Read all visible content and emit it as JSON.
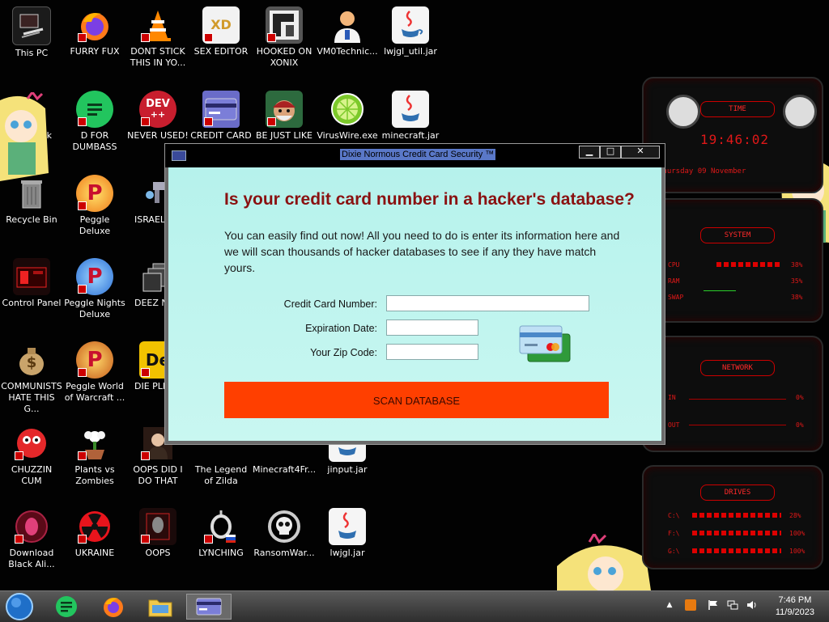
{
  "desktop": {
    "icons": [
      {
        "label": "This PC"
      },
      {
        "label": "FURRY FUX"
      },
      {
        "label": "DONT STICK THIS IN YO..."
      },
      {
        "label": "SEX EDITOR"
      },
      {
        "label": "HOOKED ON XONIX"
      },
      {
        "label": "VM0Technic..."
      },
      {
        "label": "lwjgl_util.jar"
      },
      {
        "label": "k"
      },
      {
        "label": "D FOR DUMBASS"
      },
      {
        "label": "NEVER USED!"
      },
      {
        "label": "CREDIT CARD CHECKER"
      },
      {
        "label": "BE JUST LIKE THE DUDE!"
      },
      {
        "label": "VirusWire.exe"
      },
      {
        "label": "minecraft.jar"
      },
      {
        "label": "Recycle Bin"
      },
      {
        "label": "Peggle Deluxe"
      },
      {
        "label": "ISRAELS"
      },
      {
        "label": "Control Panel"
      },
      {
        "label": "Peggle Nights Deluxe"
      },
      {
        "label": "DEEZ NU"
      },
      {
        "label": "COMMUNISTS HATE THIS G..."
      },
      {
        "label": "Peggle World of Warcraft ..."
      },
      {
        "label": "DIE PLEA"
      },
      {
        "label": "CHUZZIN CUM"
      },
      {
        "label": "Plants vs Zombies"
      },
      {
        "label": "OOPS DID I DO THAT"
      },
      {
        "label": "The Legend of Zilda"
      },
      {
        "label": "Minecraft4Fr..."
      },
      {
        "label": "jinput.jar"
      },
      {
        "label": "Download Black Ali..."
      },
      {
        "label": "UKRAINE"
      },
      {
        "label": "OOPS"
      },
      {
        "label": "LYNCHING"
      },
      {
        "label": "RansomWar..."
      },
      {
        "label": "lwjgl.jar"
      }
    ],
    "icon_glyphs": {
      "dev": "DEV",
      "dev_sub": "++",
      "xd": "XD",
      "p": "P",
      "dollar": "$",
      "de": "De"
    }
  },
  "widget": {
    "time_title": "TIME",
    "time_value": "19:46:02",
    "date_value": "Thursday 09 November",
    "system_title": "SYSTEM",
    "cpu_label": "CPU",
    "cpu_value": "38%",
    "ram_label": "RAM",
    "ram_value": "35%",
    "swap_label": "SWAP",
    "swap_value": "38%",
    "network_title": "NETWORK",
    "in_label": "IN",
    "in_value": "0%",
    "out_label": "OUT",
    "out_value": "0%",
    "drives_title": "DRIVES",
    "drives": [
      {
        "label": "C:\\",
        "value": "28%"
      },
      {
        "label": "F:\\",
        "value": "100%"
      },
      {
        "label": "G:\\",
        "value": "100%"
      }
    ]
  },
  "dialog": {
    "title": "Dixie Normous Credit Card Security ™",
    "minimize": "▁",
    "maximize": "□",
    "close": "✕",
    "headline": "Is your credit card number in a hacker's database?",
    "intro": "You can easily find out now! All you need to do is enter its information here and we will scan thousands of hacker databases to see if any they have match yours.",
    "card_number_label": "Credit Card Number:",
    "card_number_value": "",
    "expiration_label": "Expiration Date:",
    "expiration_value": "",
    "zip_label": "Your Zip Code:",
    "zip_value": "",
    "scan_button": "SCAN DATABASE"
  },
  "taskbar": {
    "time": "7:46 PM",
    "date": "11/9/2023",
    "tray_up": "▲"
  },
  "colors": {
    "headline": "#8a1111",
    "scan_button": "#ff3f00",
    "dialog_bg": "#c3f5ef",
    "widget_red": "#e01818"
  }
}
